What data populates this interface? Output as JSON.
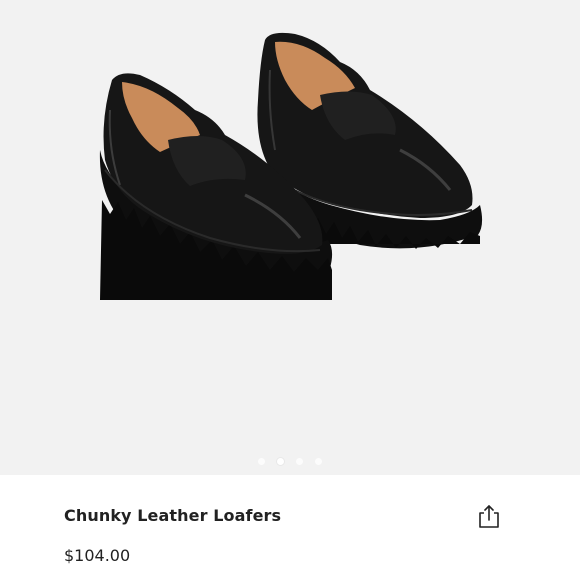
{
  "product": {
    "title": "Chunky Leather Loafers",
    "price": "$104.00"
  },
  "gallery": {
    "image_label": "black chunky leather loafers",
    "dot_count": 4,
    "active_index": 1
  },
  "icons": {
    "share": "share-icon"
  },
  "colors": {
    "background": "#f2f2f2",
    "text": "#222222"
  }
}
